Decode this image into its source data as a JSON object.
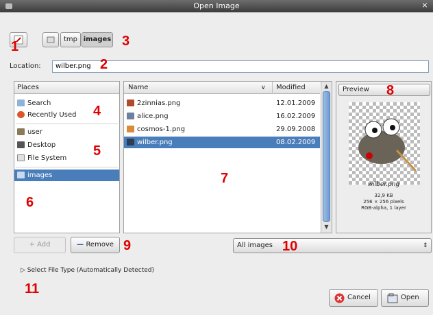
{
  "window": {
    "title": "Open Image",
    "close_glyph": "×"
  },
  "path_bar": {
    "segments": [
      "tmp",
      "images"
    ]
  },
  "location": {
    "label": "Location:",
    "value": "wilber.png"
  },
  "places": {
    "header": "Places",
    "items": [
      {
        "label": "Search",
        "icon": "search-icon"
      },
      {
        "label": "Recently Used",
        "icon": "clock-icon"
      },
      {
        "label": "user",
        "icon": "home-folder-icon"
      },
      {
        "label": "Desktop",
        "icon": "desktop-icon"
      },
      {
        "label": "File System",
        "icon": "drive-icon"
      },
      {
        "label": "images",
        "icon": "folder-icon"
      }
    ]
  },
  "files": {
    "col_name": "Name",
    "col_modified": "Modified",
    "rows": [
      {
        "name": "2zinnias.png",
        "modified": "12.01.2009"
      },
      {
        "name": "alice.png",
        "modified": "16.02.2009"
      },
      {
        "name": "cosmos-1.png",
        "modified": "29.09.2008"
      },
      {
        "name": "wilber.png",
        "modified": "08.02.2009"
      }
    ]
  },
  "preview": {
    "button_label": "Preview",
    "filename": "wilber.png",
    "size": "32,9 KB",
    "dimensions": "256 × 256 pixels",
    "mode": "RGB-alpha, 1 layer"
  },
  "buttons": {
    "add": "Add",
    "remove": "Remove",
    "cancel": "Cancel",
    "open": "Open"
  },
  "filter": {
    "value": "All images"
  },
  "file_type": {
    "label": "Select File Type (Automatically Detected)"
  },
  "callouts": [
    "1",
    "2",
    "3",
    "4",
    "5",
    "6",
    "7",
    "8",
    "9",
    "10",
    "11"
  ],
  "colors": {
    "selection": "#4a7ebb",
    "callout": "#e00000"
  }
}
